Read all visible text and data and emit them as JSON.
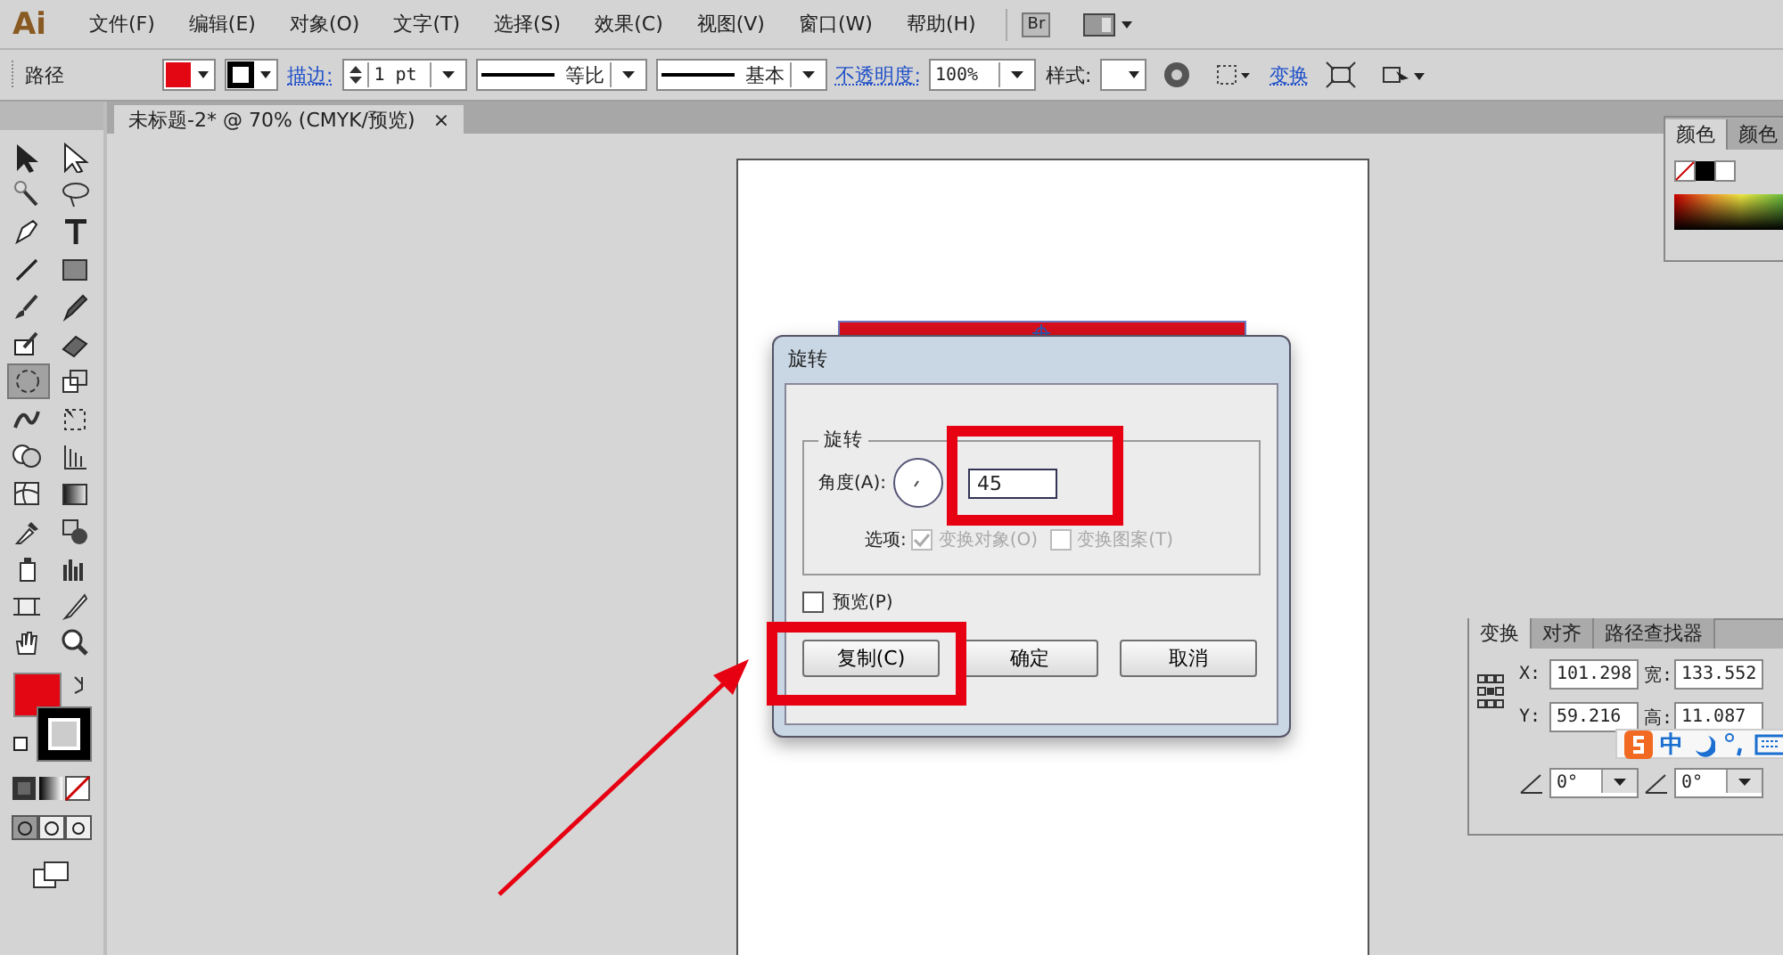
{
  "app": {
    "logo": "Ai",
    "bridge": "Br"
  },
  "menus": [
    "文件(F)",
    "编辑(E)",
    "对象(O)",
    "文字(T)",
    "选择(S)",
    "效果(C)",
    "视图(V)",
    "窗口(W)",
    "帮助(H)"
  ],
  "control_bar": {
    "object_type": "路径",
    "stroke_label": "描边:",
    "stroke_weight": "1 pt",
    "profile": "等比",
    "brush": "基本",
    "opacity_label": "不透明度:",
    "opacity": "100%",
    "style_label": "样式:",
    "transform_link": "变换"
  },
  "document_tab": {
    "title": "未标题-2* @ 70% (CMYK/预览)",
    "close": "×"
  },
  "tools": [
    {
      "kind": "select",
      "selected": false
    },
    {
      "kind": "direct",
      "selected": false
    },
    {
      "kind": "wand",
      "selected": false
    },
    {
      "kind": "lasso",
      "selected": false
    },
    {
      "kind": "pen",
      "selected": false
    },
    {
      "kind": "type",
      "selected": false
    },
    {
      "kind": "line",
      "selected": false
    },
    {
      "kind": "rect",
      "selected": false
    },
    {
      "kind": "brush",
      "selected": false
    },
    {
      "kind": "pencil",
      "selected": false
    },
    {
      "kind": "blob",
      "selected": false
    },
    {
      "kind": "eraser",
      "selected": false
    },
    {
      "kind": "rotate",
      "selected": true
    },
    {
      "kind": "scale",
      "selected": false
    },
    {
      "kind": "warp",
      "selected": false
    },
    {
      "kind": "free",
      "selected": false
    },
    {
      "kind": "builder",
      "selected": false
    },
    {
      "kind": "perspective",
      "selected": false
    },
    {
      "kind": "mesh",
      "selected": false
    },
    {
      "kind": "gradient",
      "selected": false
    },
    {
      "kind": "eyedropper",
      "selected": false
    },
    {
      "kind": "blend",
      "selected": false
    },
    {
      "kind": "sprayer",
      "selected": false
    },
    {
      "kind": "graph",
      "selected": false
    },
    {
      "kind": "artboard",
      "selected": false
    },
    {
      "kind": "slice",
      "selected": false
    },
    {
      "kind": "hand",
      "selected": false
    },
    {
      "kind": "zoom",
      "selected": false
    }
  ],
  "dialog": {
    "title": "旋转",
    "group_title": "旋转",
    "angle_label": "角度(A):",
    "angle": "45",
    "options_label": "选项:",
    "options": [
      {
        "label": "变换对象(O)",
        "checked": true,
        "disabled": true
      },
      {
        "label": "变换图案(T)",
        "checked": false,
        "disabled": true
      }
    ],
    "preview": {
      "label": "预览(P)",
      "checked": false
    },
    "buttons": [
      "复制(C)",
      "确定",
      "取消"
    ]
  },
  "color_panel": {
    "tabs": [
      {
        "label": "颜色",
        "selected": true
      },
      {
        "label": "颜色",
        "selected": false
      }
    ]
  },
  "transform_panel": {
    "tabs": [
      {
        "label": "变换",
        "selected": true
      },
      {
        "label": "对齐",
        "selected": false
      },
      {
        "label": "路径查找器",
        "selected": false
      }
    ],
    "fields": [
      {
        "label": "X:",
        "value": "101.298"
      },
      {
        "label": "宽:",
        "value": "133.552"
      },
      {
        "label": "Y:",
        "value": "59.216"
      },
      {
        "label": "高:",
        "value": "11.087"
      }
    ],
    "angles": [
      "0°",
      "0°"
    ]
  },
  "ime_bar": {
    "mode": "中"
  }
}
